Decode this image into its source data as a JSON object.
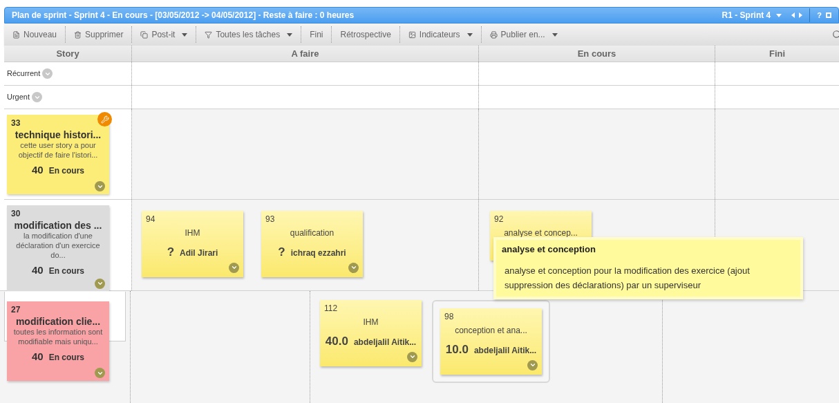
{
  "window": {
    "title": "Plan de sprint - Sprint 4 - En cours - [03/05/2012 -> 04/05/2012] - Reste à faire : 0 heures",
    "sprint_selector": "R1 - Sprint 4",
    "help": "?"
  },
  "toolbar": [
    {
      "label": "Nouveau",
      "dropdown": false
    },
    {
      "label": "Supprimer",
      "dropdown": false
    },
    {
      "label": "Post-it",
      "dropdown": true
    },
    {
      "label": "Toutes les tâches",
      "dropdown": true
    },
    {
      "label": "Fini",
      "dropdown": false
    },
    {
      "label": "Rétrospective",
      "dropdown": false
    },
    {
      "label": "Indicateurs",
      "dropdown": true
    },
    {
      "label": "Publier en...",
      "dropdown": true
    }
  ],
  "columns": [
    "Story",
    "A faire",
    "En cours",
    "Fini"
  ],
  "lanes": [
    {
      "label": "Récurrent"
    },
    {
      "label": "Urgent"
    }
  ],
  "stories": [
    {
      "id": "33",
      "title": "technique histori...",
      "description": "cette user story a pour objectif de faire l'istori...",
      "points": "40",
      "state": "En cours",
      "color": "#fcec78",
      "technical": true,
      "kind": "normal"
    },
    {
      "id": "30",
      "title": "modification des ...",
      "description": "la modification d'une déclaration d'un exercice do...",
      "points": "40",
      "state": "En cours",
      "color": "#dcdcdc",
      "technical": false,
      "kind": "normal",
      "todo": [
        {
          "id": "94",
          "title": "IHM",
          "estimate": "?",
          "assignee": "Adil Jirari",
          "selected": false
        },
        {
          "id": "93",
          "title": "qualification",
          "estimate": "?",
          "assignee": "ichraq ezzahri",
          "selected": false
        }
      ],
      "in_progress": [
        {
          "id": "92",
          "title": "analyse et concep...",
          "selected": false,
          "tooltip": {
            "title": "analyse et conception",
            "text": "analyse et conception pour la modification des exercice (ajout suppression des déclarations) par un superviseur"
          }
        }
      ]
    },
    {
      "id": "27",
      "title": "modification clie...",
      "description": "toutes les information sont modifiable mais uniqu...",
      "points": "40",
      "state": "En cours",
      "color": "#f9a3a6",
      "technical": false,
      "kind": "dragging",
      "in_progress": [
        {
          "id": "112",
          "title": "IHM",
          "estimate": "40.0",
          "assignee": "abdeljalil Aitik...",
          "selected": false
        },
        {
          "id": "98",
          "title": "conception et ana...",
          "estimate": "10.0",
          "assignee": "abdeljalil Aitik...",
          "selected": true
        }
      ]
    }
  ]
}
